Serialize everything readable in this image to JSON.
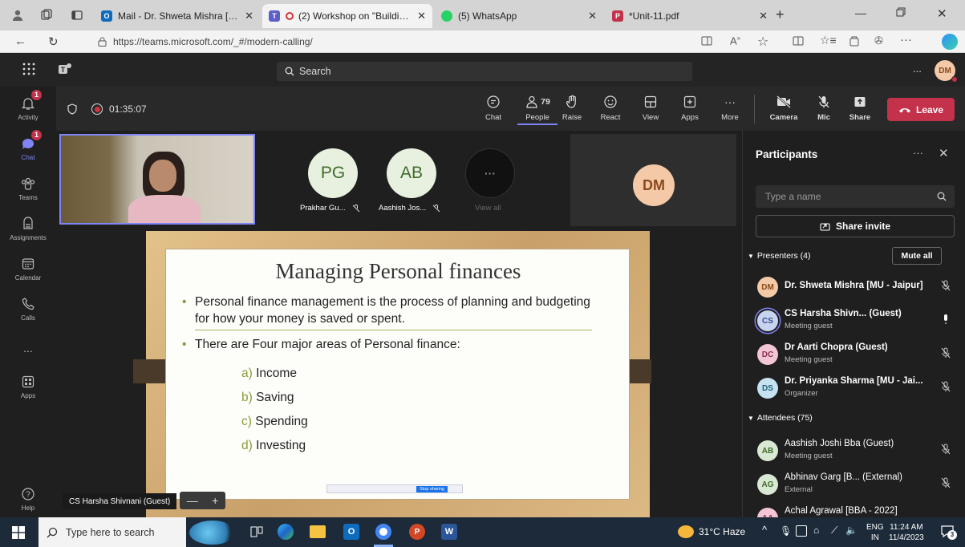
{
  "browser": {
    "tabs": [
      {
        "title": "Mail - Dr. Shweta Mishra [MU - J",
        "active": false
      },
      {
        "title": "(2) Workshop on \"Building A",
        "active": true
      },
      {
        "title": "(5) WhatsApp",
        "active": false
      },
      {
        "title": "*Unit-11.pdf",
        "active": false
      }
    ],
    "new_tab": "+",
    "url": "https://teams.microsoft.com/_#/modern-calling/",
    "profile_initials": "DM"
  },
  "teams": {
    "search_placeholder": "Search",
    "more": "...",
    "user_initials": "DM"
  },
  "rail": {
    "items": [
      {
        "label": "Activity",
        "icon": "bell-icon",
        "badge": "1"
      },
      {
        "label": "Chat",
        "icon": "chat-icon",
        "badge": "1"
      },
      {
        "label": "Teams",
        "icon": "teams-icon"
      },
      {
        "label": "Assignments",
        "icon": "assignments-icon"
      },
      {
        "label": "Calendar",
        "icon": "calendar-icon"
      },
      {
        "label": "Calls",
        "icon": "phone-icon"
      },
      {
        "label": "...",
        "icon": "more-icon"
      },
      {
        "label": "Apps",
        "icon": "apps-icon"
      }
    ],
    "help": "Help"
  },
  "meeting": {
    "timer": "01:35:07",
    "toolbar": {
      "chat": "Chat",
      "people": "People",
      "people_count": "79",
      "raise": "Raise",
      "react": "React",
      "view": "View",
      "apps": "Apps",
      "more": "More",
      "camera": "Camera",
      "mic": "Mic",
      "share": "Share",
      "leave": "Leave"
    },
    "tiles": [
      {
        "initials": "PG",
        "name": "Prakhar Gu..."
      },
      {
        "initials": "AB",
        "name": "Aashish Jos..."
      }
    ],
    "view_all": "View all",
    "self_initials": "DM",
    "presenter_name": "CS Harsha Shivnani (Guest)",
    "slide": {
      "title": "Managing Personal finances",
      "bullets": [
        "Personal finance management is the process of planning and budgeting for how your money is saved or spent.",
        "There are Four major areas of Personal finance:"
      ],
      "items": [
        {
          "letter": "a)",
          "text": "Income"
        },
        {
          "letter": "b)",
          "text": "Saving"
        },
        {
          "letter": "c)",
          "text": "Spending"
        },
        {
          "letter": "d)",
          "text": "Investing"
        }
      ],
      "stop_sharing": "Stop sharing"
    }
  },
  "participants": {
    "title": "Participants",
    "search_placeholder": "Type a name",
    "share_invite": "Share invite",
    "presenters_label": "Presenters (4)",
    "mute_all": "Mute all",
    "presenters": [
      {
        "initials": "DM",
        "name": "Dr. Shweta Mishra [MU - Jaipur]",
        "sub": "",
        "color": "#f4c9a8",
        "fg": "#8a4a1c"
      },
      {
        "initials": "CS",
        "name": "CS Harsha Shivn... (Guest)",
        "sub": "Meeting guest",
        "color": "#c8d3f0",
        "fg": "#3b4f8c"
      },
      {
        "initials": "DC",
        "name": "Dr Aarti Chopra (Guest)",
        "sub": "Meeting guest",
        "color": "#f2c6d4",
        "fg": "#8c2f4f"
      },
      {
        "initials": "DS",
        "name": "Dr. Priyanka Sharma [MU - Jai...",
        "sub": "Organizer",
        "color": "#c6e2f0",
        "fg": "#1f5f7a"
      }
    ],
    "attendees_label": "Attendees (75)",
    "attendees": [
      {
        "initials": "AB",
        "name": "Aashish Joshi Bba (Guest)",
        "sub": "Meeting guest",
        "color": "#d9e8d2",
        "fg": "#3f6b2c"
      },
      {
        "initials": "AG",
        "name": "Abhinav Garg [B... (External)",
        "sub": "External",
        "color": "#d9e8d2",
        "fg": "#3f6b2c"
      },
      {
        "initials": "AA",
        "name": "Achal Agrawal [BBA - 2022]",
        "sub": "",
        "color": "#f2c6d4",
        "fg": "#8c2f4f"
      }
    ]
  },
  "taskbar": {
    "search_placeholder": "Type here to search",
    "weather": "31°C  Haze",
    "lang": "ENG",
    "region": "IN",
    "time": "11:24 AM",
    "date": "11/4/2023",
    "notifications": "3"
  }
}
